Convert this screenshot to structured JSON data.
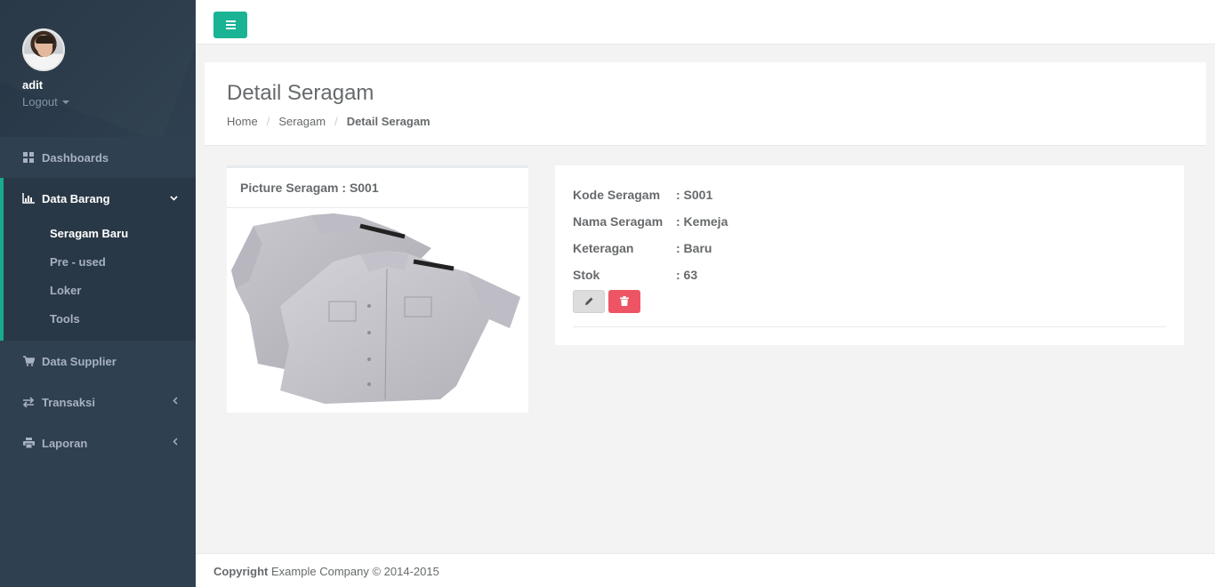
{
  "sidebar": {
    "username": "adit",
    "logout_label": "Logout",
    "items": [
      {
        "label": "Dashboards",
        "icon": "th-large-icon"
      },
      {
        "label": "Data Barang",
        "icon": "bar-chart-icon",
        "expanded": true,
        "children": [
          "Seragam Baru",
          "Pre - used",
          "Loker",
          "Tools"
        ]
      },
      {
        "label": "Data Supplier",
        "icon": "shopping-cart-icon"
      },
      {
        "label": "Transaksi",
        "icon": "exchange-icon"
      },
      {
        "label": "Laporan",
        "icon": "print-icon"
      }
    ],
    "selected_child": "Seragam Baru"
  },
  "header": {
    "page_title": "Detail Seragam",
    "breadcrumb": [
      "Home",
      "Seragam",
      "Detail Seragam"
    ]
  },
  "picture_panel": {
    "title": "Picture Seragam : S001"
  },
  "detail": {
    "rows": [
      {
        "label": "Kode Seragam",
        "value": ": S001"
      },
      {
        "label": "Nama Seragam",
        "value": ": Kemeja"
      },
      {
        "label": "Keteragan",
        "value": ": Baru"
      },
      {
        "label": "Stok",
        "value": ": 63"
      }
    ]
  },
  "footer": {
    "copyright_label": "Copyright",
    "text": "Example Company © 2014-2015"
  },
  "colors": {
    "sidebar_bg": "#2f4050",
    "accent": "#1ab394",
    "danger": "#ed5565"
  }
}
